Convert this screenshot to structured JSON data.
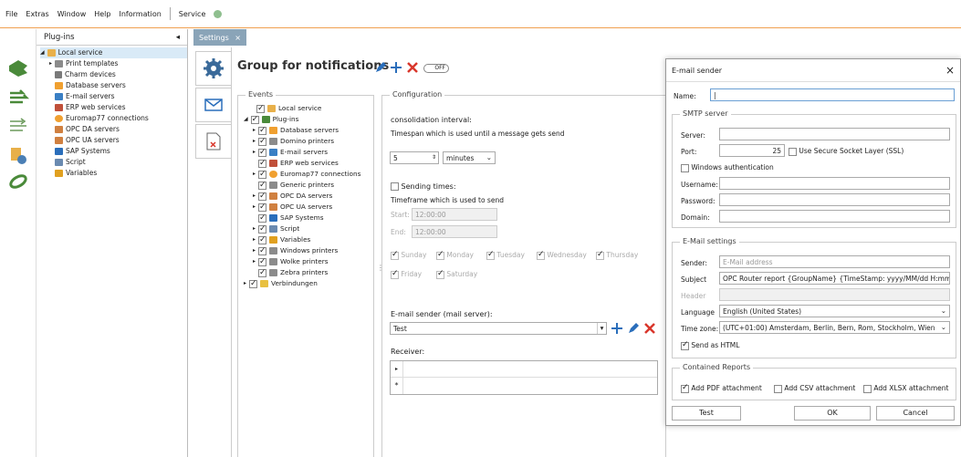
{
  "menu": {
    "file": "File",
    "extras": "Extras",
    "window": "Window",
    "help": "Help",
    "information": "Information",
    "service": "Service"
  },
  "plugins_panel": {
    "title": "Plug-ins",
    "collapse": "◂",
    "tree": [
      "Local service",
      "Print templates",
      "Charm devices",
      "Database servers",
      "E-mail servers",
      "ERP web services",
      "Euromap77 connections",
      "OPC DA servers",
      "OPC UA servers",
      "SAP Systems",
      "Script",
      "Variables"
    ]
  },
  "tab": {
    "label": "Settings",
    "close": "×"
  },
  "header": {
    "title": "Group for notifications",
    "toggle": "OFF"
  },
  "events": {
    "legend": "Events",
    "tree": [
      "Local service",
      "Plug-ins",
      "Database servers",
      "Domino printers",
      "E-mail servers",
      "ERP web services",
      "Euromap77 connections",
      "Generic printers",
      "OPC DA servers",
      "OPC UA servers",
      "SAP Systems",
      "Script",
      "Variables",
      "Windows printers",
      "Wolke printers",
      "Zebra printers",
      "Verbindungen"
    ]
  },
  "config": {
    "legend": "Configuration",
    "consolidation_label": "consolidation interval:",
    "consolidation_desc": "Timespan which is used until a message gets send",
    "interval_value": "5",
    "interval_unit": "minutes",
    "sending_times": "Sending times:",
    "timeframe_desc": "Timeframe which is used to send",
    "start_label": "Start:",
    "start_value": "12:00:00",
    "end_label": "End:",
    "end_value": "12:00:00",
    "days": [
      "Sunday",
      "Monday",
      "Tuesday",
      "Wednesday",
      "Thursday",
      "Friday",
      "Saturday"
    ],
    "sender_label": "E-mail sender (mail server):",
    "sender_value": "Test",
    "receiver_label": "Receiver:",
    "row_marker": "*"
  },
  "dialog": {
    "title": "E-mail sender",
    "close": "×",
    "name_label": "Name:",
    "name_value": "",
    "smtp_legend": "SMTP server",
    "server_label": "Server:",
    "server_value": "",
    "port_label": "Port:",
    "port_value": "25",
    "ssl_label": "Use Secure Socket Layer (SSL)",
    "winauth_label": "Windows authentication",
    "username_label": "Username:",
    "password_label": "Password:",
    "domain_label": "Domain:",
    "email_legend": "E-Mail settings",
    "sender_label": "Sender:",
    "sender_placeholder": "E-Mail address",
    "subject_label": "Subject",
    "subject_value": "OPC Router report {GroupName} {TimeStamp: yyyy/MM/dd H:mm:ss",
    "header_label": "Header",
    "language_label": "Language",
    "language_value": "English (United States)",
    "timezone_label": "Time zone:",
    "timezone_value": "(UTC+01:00) Amsterdam, Berlin, Bern, Rom, Stockholm, Wien",
    "send_html": "Send as HTML",
    "reports_legend": "Contained Reports",
    "pdf": "Add PDF attachment",
    "csv": "Add CSV attachment",
    "xlsx": "Add XLSX attachment",
    "test_btn": "Test",
    "ok_btn": "OK",
    "cancel_btn": "Cancel"
  },
  "colors": {
    "accent": "#f0a050",
    "tab": "#8aa4b8",
    "red": "#d9362b",
    "blue": "#2a6ebb",
    "green": "#4a8a3a"
  }
}
